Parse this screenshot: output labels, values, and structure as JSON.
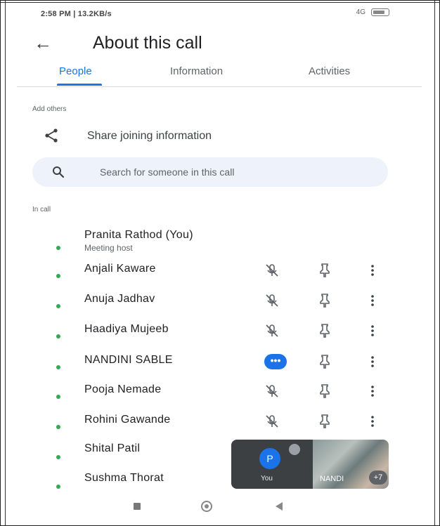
{
  "status_bar": {
    "time_info": "2:58 PM | 13.2KB/s",
    "signal": "4G"
  },
  "header": {
    "back_glyph": "←",
    "title": "About this call"
  },
  "tabs": [
    {
      "label": "People",
      "active": true
    },
    {
      "label": "Information",
      "active": false
    },
    {
      "label": "Activities",
      "active": false
    }
  ],
  "add_others": {
    "section_label": "Add others",
    "share_label": "Share joining information"
  },
  "search": {
    "placeholder": "Search for someone in this call"
  },
  "in_call": {
    "section_label": "In call",
    "participants": [
      {
        "name": "Pranita Rathod (You)",
        "subtitle": "Meeting host"
      },
      {
        "name": "Anjali Kaware",
        "mic": "muted"
      },
      {
        "name": "Anuja Jadhav",
        "mic": "muted"
      },
      {
        "name": "Haadiya Mujeeb",
        "mic": "muted"
      },
      {
        "name": "NANDINI SABLE",
        "mic": "speaking",
        "badge": "•••"
      },
      {
        "name": "Pooja Nemade",
        "mic": "muted"
      },
      {
        "name": "Rohini Gawande",
        "mic": "muted"
      },
      {
        "name": "Shital Patil"
      },
      {
        "name": "Sushma Thorat"
      }
    ]
  },
  "pip": {
    "self_initial": "P",
    "self_label": "You",
    "other_label": "NANDI",
    "count": "+7"
  },
  "colors": {
    "accent": "#1a73e8",
    "online_dot": "#34a853",
    "search_bg": "#eef3fb"
  }
}
